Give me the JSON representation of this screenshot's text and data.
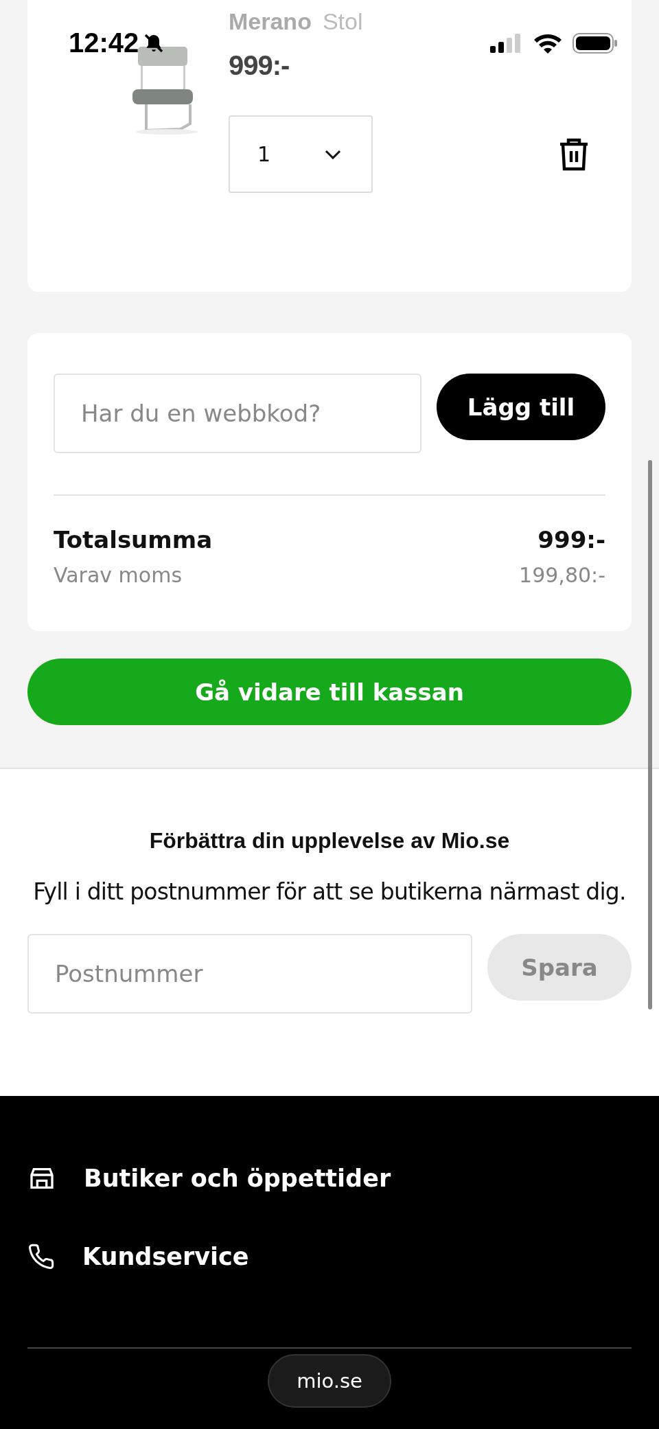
{
  "status_bar": {
    "time": "12:42",
    "muted": true
  },
  "cart_item": {
    "name": "Merano",
    "type": "Stol",
    "price": "999:-",
    "quantity": "1"
  },
  "discount": {
    "placeholder": "Har du en webbkod?",
    "button": "Lägg till"
  },
  "totals": {
    "label": "Totalsumma",
    "value": "999:-",
    "vat_label": "Varav moms",
    "vat_value": "199,80:-"
  },
  "checkout_button": "Gå vidare till kassan",
  "postcode": {
    "title": "Förbättra din upplevelse av Mio.se",
    "text": "Fyll i ditt postnummer för att se butikerna närmast dig.",
    "placeholder": "Postnummer",
    "button": "Spara"
  },
  "footer_links": [
    {
      "kind": "store",
      "label": "Butiker och öppettider"
    },
    {
      "kind": "phone",
      "label": "Kundservice"
    }
  ],
  "url_pill": "mio.se"
}
